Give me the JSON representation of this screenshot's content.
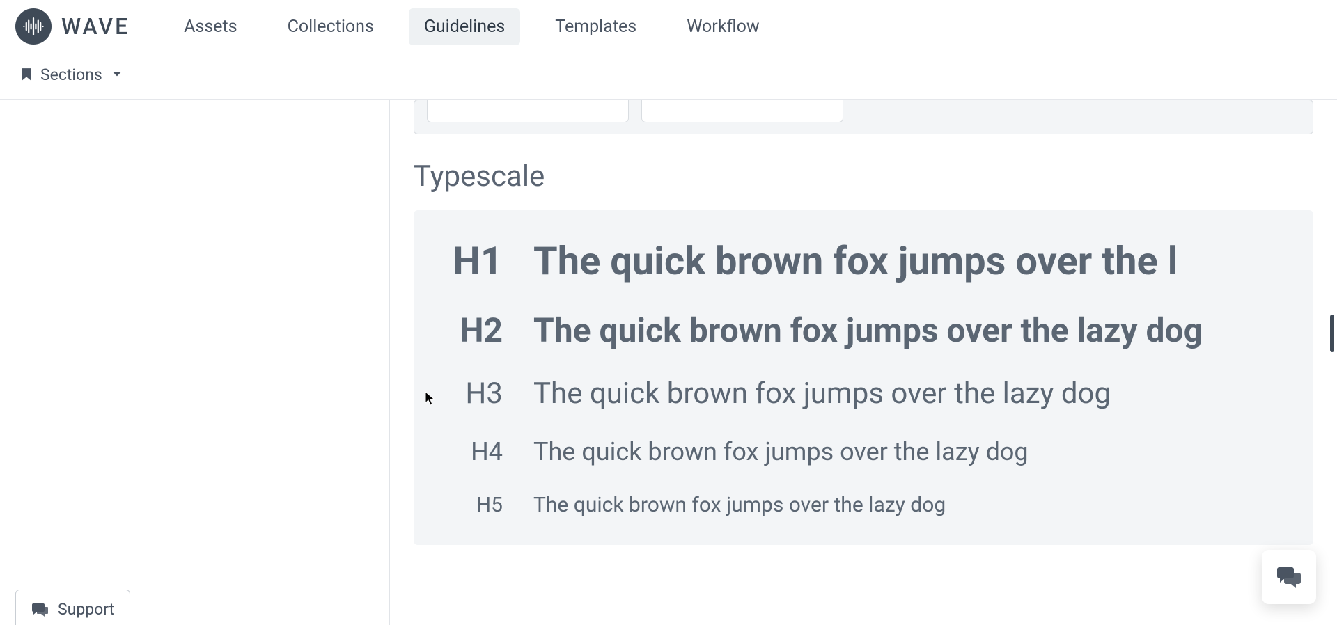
{
  "brand": {
    "name": "WAVE"
  },
  "nav": {
    "tabs": [
      {
        "label": "Assets",
        "active": false
      },
      {
        "label": "Collections",
        "active": false
      },
      {
        "label": "Guidelines",
        "active": true
      },
      {
        "label": "Templates",
        "active": false
      },
      {
        "label": "Workflow",
        "active": false
      }
    ],
    "sections_label": "Sections"
  },
  "content": {
    "section_title": "Typescale",
    "typescale": [
      {
        "label": "H1",
        "sample": "The quick brown fox jumps over the l"
      },
      {
        "label": "H2",
        "sample": "The quick brown fox jumps over the lazy dog"
      },
      {
        "label": "H3",
        "sample": "The quick brown fox jumps over the lazy dog"
      },
      {
        "label": "H4",
        "sample": "The quick brown fox jumps over the lazy dog"
      },
      {
        "label": "H5",
        "sample": "The quick brown fox jumps over the lazy dog"
      }
    ]
  },
  "footer": {
    "support_label": "Support"
  }
}
